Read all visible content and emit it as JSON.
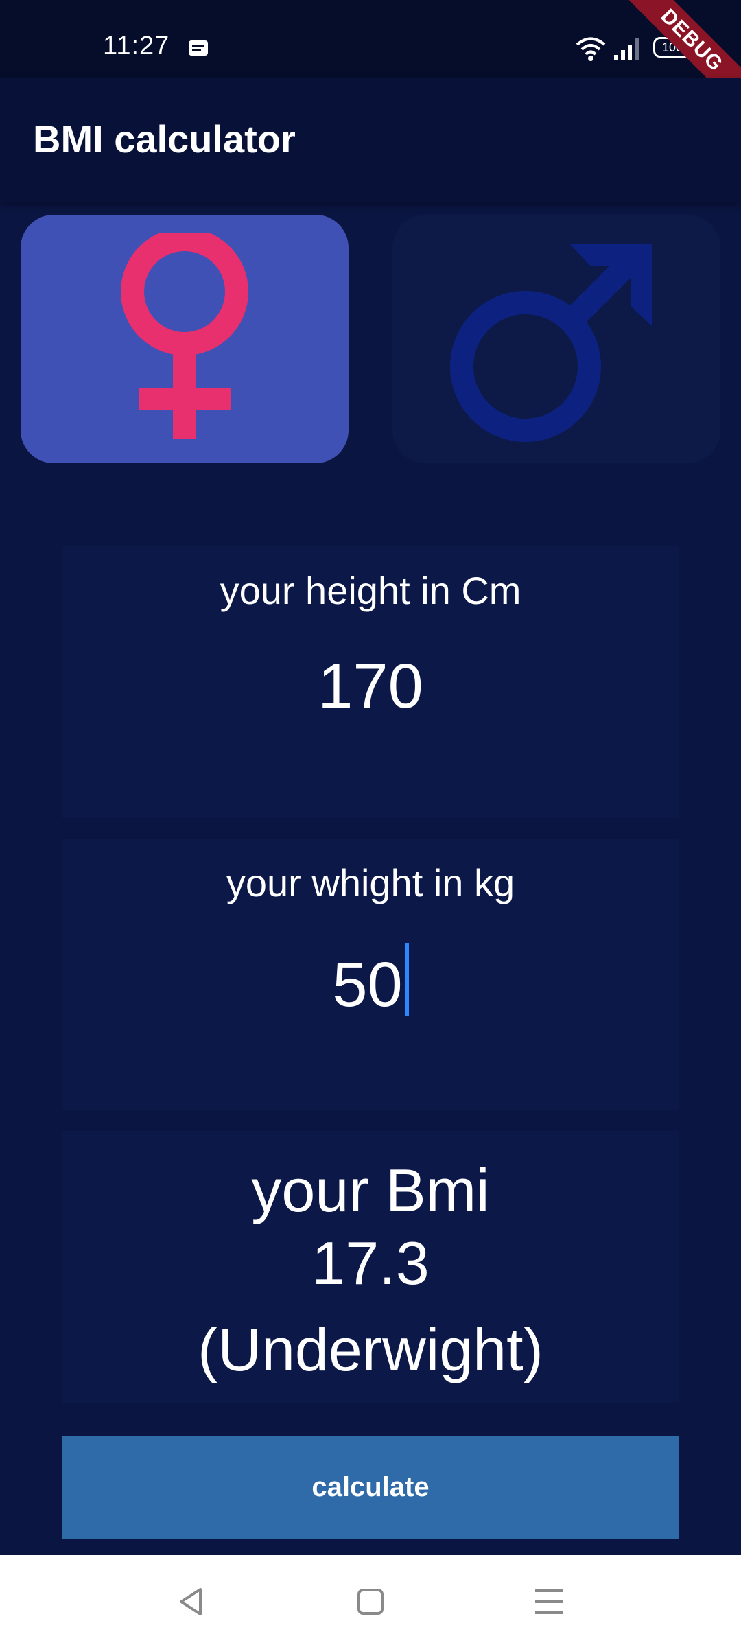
{
  "status_bar": {
    "time": "11:27",
    "battery": "100"
  },
  "debug_banner": "DEBUG",
  "app_bar": {
    "title": "BMI calculator"
  },
  "gender": {
    "selected": "female",
    "female_color": "#e8306e",
    "male_color": "#0d2280",
    "selected_bg": "#3f51b5",
    "unselected_bg": "#0d1a47"
  },
  "height_card": {
    "label": "your height in Cm",
    "value": "170"
  },
  "weight_card": {
    "label": "your whight in kg",
    "value": "50"
  },
  "bmi_card": {
    "title": "your Bmi",
    "value": "17.3",
    "status": "(Underwight)"
  },
  "calculate_button": {
    "label": "calculate"
  },
  "colors": {
    "background": "#0a1541",
    "card": "#0c1848",
    "button": "#2f6ba8",
    "caret": "#2f86ff"
  }
}
